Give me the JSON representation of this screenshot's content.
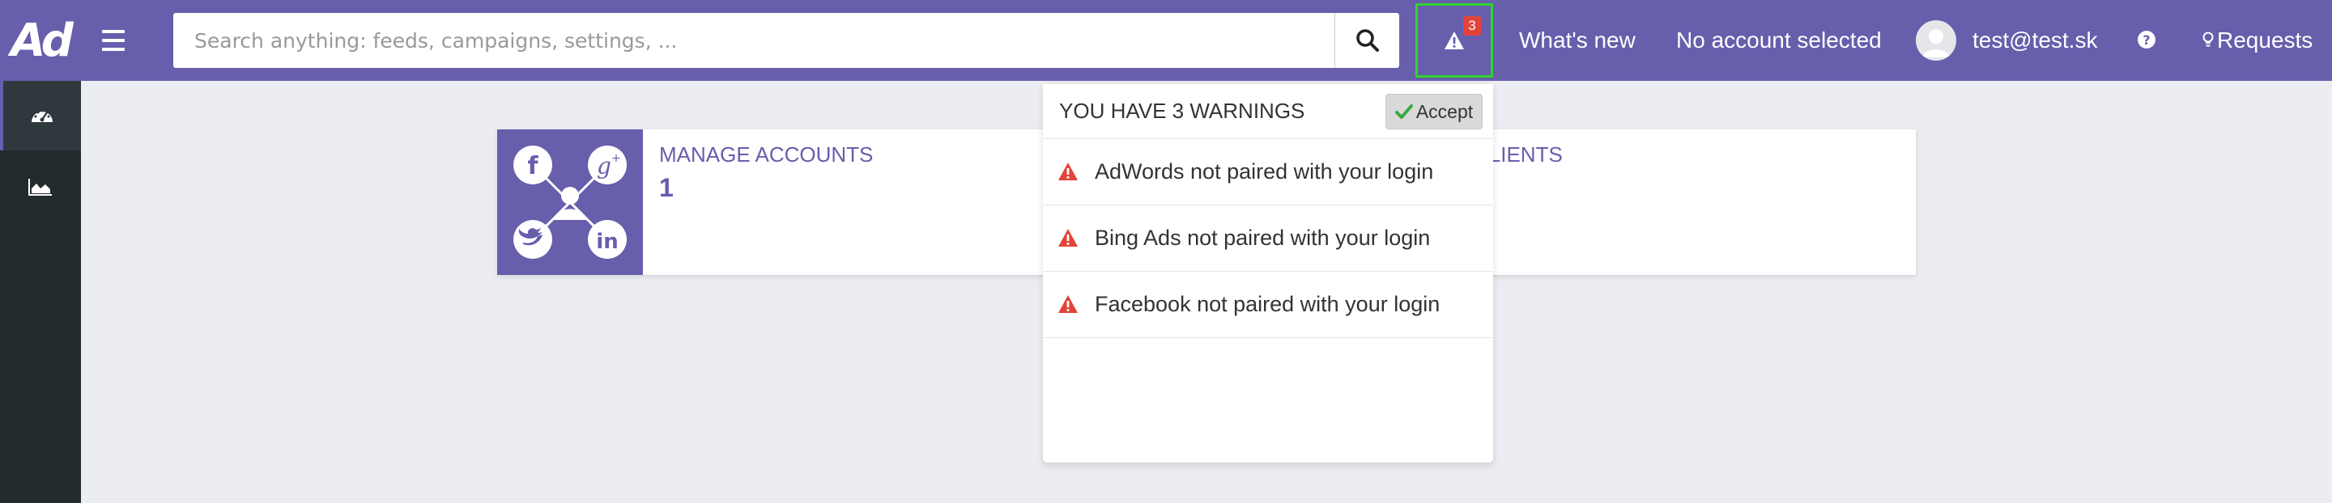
{
  "app": {
    "logo_text": "Ad"
  },
  "header": {
    "menu_icon": "hamburger-icon",
    "search": {
      "placeholder": "Search anything: feeds, campaigns, settings, ...",
      "value": "",
      "icon": "search-icon"
    },
    "warnings": {
      "icon": "warning-icon",
      "badge_count": "3"
    },
    "whats_new": "What's new",
    "account_status": "No account selected",
    "user_email": "test@test.sk",
    "help_icon": "question-circle-icon",
    "requests_label": "Requests",
    "requests_icon": "lightbulb-icon"
  },
  "sidebar": {
    "items": [
      {
        "name": "dashboard",
        "icon": "dashboard-icon",
        "active": true
      },
      {
        "name": "statistics",
        "icon": "area-chart-icon",
        "active": false
      }
    ]
  },
  "cards": [
    {
      "title": "MANAGE ACCOUNTS",
      "value": "1",
      "icon_names": [
        "facebook-icon",
        "google-plus-icon",
        "twitter-icon",
        "linkedin-icon",
        "user-icon"
      ]
    },
    {
      "title": "CLIENTS",
      "value": ""
    }
  ],
  "warnings_dropdown": {
    "title": "YOU HAVE 3 WARNINGS",
    "accept_label": "Accept",
    "items": [
      {
        "text": "AdWords not paired with your login"
      },
      {
        "text": "Bing Ads not paired with your login"
      },
      {
        "text": "Facebook not paired with your login"
      }
    ]
  },
  "colors": {
    "brand": "#675eac",
    "sidebar": "#232b2f",
    "warning": "#e2443a",
    "highlight": "#2fd32f",
    "accept_check": "#3aa843"
  }
}
